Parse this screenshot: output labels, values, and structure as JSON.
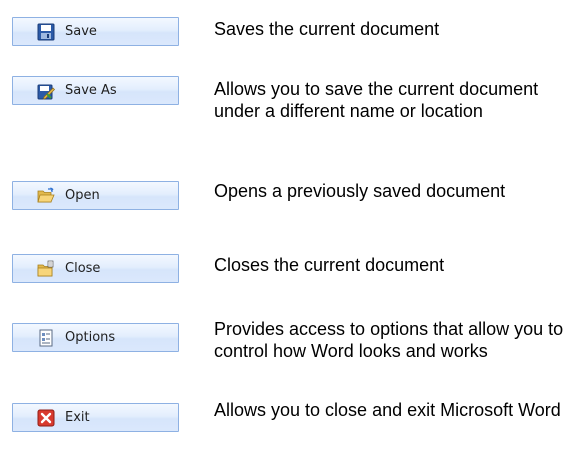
{
  "items": [
    {
      "label": "Save",
      "icon": "floppy-disk-icon",
      "description": "Saves the current document"
    },
    {
      "label": "Save As",
      "icon": "save-as-icon",
      "description": "Allows you to save the current document under a different name or location"
    },
    {
      "label": "Open",
      "icon": "open-folder-icon",
      "description": "Opens a previously saved document"
    },
    {
      "label": "Close",
      "icon": "close-folder-icon",
      "description": "Closes the current document"
    },
    {
      "label": "Options",
      "icon": "options-document-icon",
      "description": "Provides access to options that allow you to control how Word looks and works"
    },
    {
      "label": "Exit",
      "icon": "exit-icon",
      "description": "Allows you to close and exit Microsoft Word"
    }
  ],
  "colors": {
    "button_border": "#8eb1e3",
    "button_fill": "#dbe8fc",
    "exit_red": "#d83a2e"
  }
}
